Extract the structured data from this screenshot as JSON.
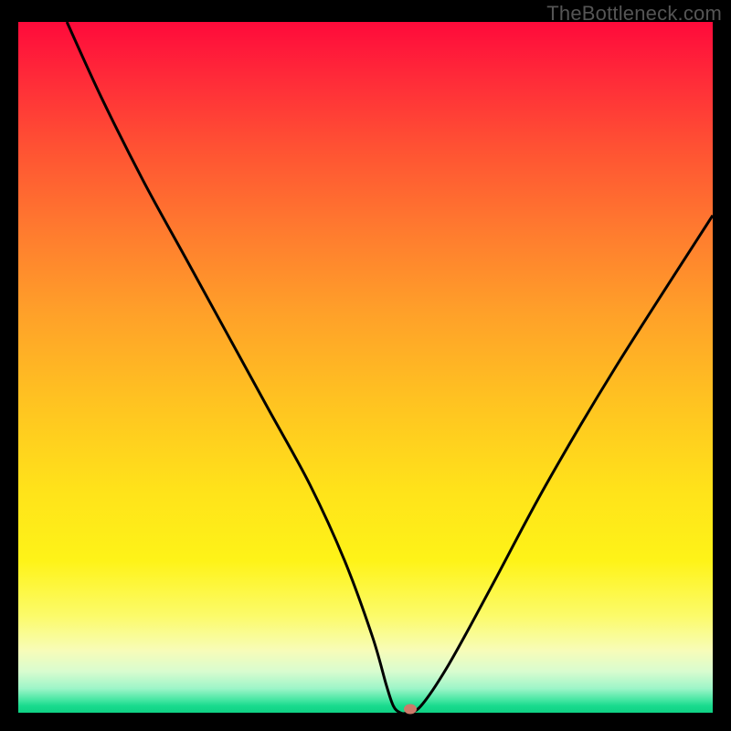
{
  "watermark": "TheBottleneck.com",
  "chart_data": {
    "type": "line",
    "title": "",
    "xlabel": "",
    "ylabel": "",
    "xlim": [
      0,
      100
    ],
    "ylim": [
      0,
      100
    ],
    "grid": false,
    "curve": {
      "name": "bottleneck-curve",
      "color": "#000000",
      "x": [
        7,
        12,
        18,
        24,
        30,
        36,
        42,
        47,
        51,
        53,
        54,
        55,
        56,
        58,
        62,
        68,
        76,
        86,
        100
      ],
      "y": [
        100,
        89,
        77,
        66,
        55,
        44,
        33,
        22,
        11,
        4,
        1,
        0,
        0,
        1,
        7,
        18,
        33,
        50,
        72
      ]
    },
    "marker": {
      "x": 56.5,
      "y": 0.5,
      "color": "#cc7a6a"
    },
    "background_gradient": {
      "top": "#ff0a3a",
      "mid": "#ffe31a",
      "bottom": "#0fd184"
    }
  }
}
